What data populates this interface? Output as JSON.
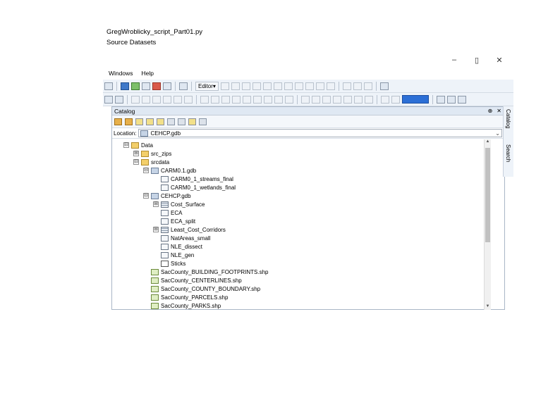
{
  "document": {
    "title": "GregWroblicky_script_Part01.py",
    "subtitle": "Source Datasets"
  },
  "window": {
    "minimize_glyph": "–",
    "maximize_glyph": "▯",
    "close_glyph": "✕"
  },
  "menubar": {
    "items": [
      "Windows",
      "Help"
    ]
  },
  "toolbar": {
    "editor_label": "Editor▾"
  },
  "catalog": {
    "title": "Catalog",
    "pin_glyph": "⊕",
    "close_glyph": "✕",
    "location_label": "Location:",
    "location_value": "CEHCP.gdb",
    "tree": [
      {
        "label": "Data",
        "type": "folder",
        "level": 1,
        "expander": "⊟"
      },
      {
        "label": "src_zips",
        "type": "folder",
        "level": 2,
        "expander": "⊞"
      },
      {
        "label": "srcdata",
        "type": "folder",
        "level": 2,
        "expander": "⊟"
      },
      {
        "label": "CARM0.1.gdb",
        "type": "gdb",
        "level": 3,
        "expander": "⊟"
      },
      {
        "label": "CARM0_1_streams_final",
        "type": "fc",
        "level": 4,
        "expander": ""
      },
      {
        "label": "CARM0_1_wetlands_final",
        "type": "fc",
        "level": 4,
        "expander": ""
      },
      {
        "label": "CEHCP.gdb",
        "type": "gdb",
        "level": 3,
        "expander": "⊟"
      },
      {
        "label": "Cost_Surface",
        "type": "table",
        "level": 4,
        "expander": "⊞"
      },
      {
        "label": "ECA",
        "type": "fc",
        "level": 4,
        "expander": ""
      },
      {
        "label": "ECA_split",
        "type": "fc",
        "level": 4,
        "expander": ""
      },
      {
        "label": "Least_Cost_Corridors",
        "type": "table",
        "level": 4,
        "expander": "⊞"
      },
      {
        "label": "NatAreas_small",
        "type": "fc",
        "level": 4,
        "expander": ""
      },
      {
        "label": "NLE_dissect",
        "type": "fc",
        "level": 4,
        "expander": ""
      },
      {
        "label": "NLE_gen",
        "type": "fc",
        "level": 4,
        "expander": ""
      },
      {
        "label": "Sticks",
        "type": "pt",
        "level": 4,
        "expander": ""
      },
      {
        "label": "SacCounty_BUILDING_FOOTPRINTS.shp",
        "type": "shp",
        "level": 3,
        "expander": ""
      },
      {
        "label": "SacCounty_CENTERLINES.shp",
        "type": "shp",
        "level": 3,
        "expander": ""
      },
      {
        "label": "SacCounty_COUNTY_BOUNDARY.shp",
        "type": "shp",
        "level": 3,
        "expander": ""
      },
      {
        "label": "SacCounty_PARCELS.shp",
        "type": "shp",
        "level": 3,
        "expander": ""
      },
      {
        "label": "SacCounty_PARKS.shp",
        "type": "shp",
        "level": 3,
        "expander": ""
      }
    ]
  },
  "sidetabs": [
    "Catalog",
    "Search"
  ]
}
